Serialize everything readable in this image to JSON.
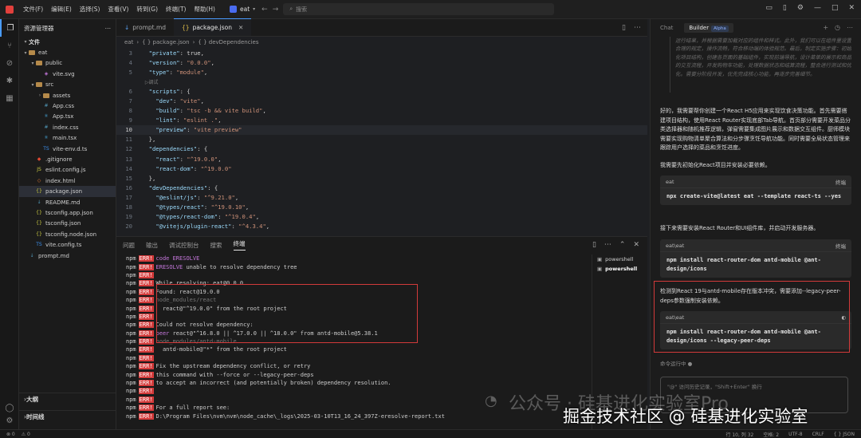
{
  "titlebar": {
    "menus": [
      "文件(F)",
      "编辑(E)",
      "选择(S)",
      "查看(V)",
      "转到(G)",
      "终端(T)",
      "帮助(H)"
    ],
    "project": "eat",
    "search_placeholder": "搜索"
  },
  "explorer": {
    "title": "资源管理器",
    "section": "文件",
    "items": [
      {
        "label": "eat",
        "depth": 0,
        "type": "folder",
        "open": true
      },
      {
        "label": "public",
        "depth": 1,
        "type": "folder",
        "open": true
      },
      {
        "label": "vite.svg",
        "depth": 2,
        "type": "svg"
      },
      {
        "label": "src",
        "depth": 1,
        "type": "folder",
        "open": true
      },
      {
        "label": "assets",
        "depth": 2,
        "type": "folder",
        "open": false
      },
      {
        "label": "App.css",
        "depth": 2,
        "type": "css"
      },
      {
        "label": "App.tsx",
        "depth": 2,
        "type": "tsx"
      },
      {
        "label": "index.css",
        "depth": 2,
        "type": "css"
      },
      {
        "label": "main.tsx",
        "depth": 2,
        "type": "tsx"
      },
      {
        "label": "vite-env.d.ts",
        "depth": 2,
        "type": "ts"
      },
      {
        "label": ".gitignore",
        "depth": 1,
        "type": "git"
      },
      {
        "label": "eslint.config.js",
        "depth": 1,
        "type": "js"
      },
      {
        "label": "index.html",
        "depth": 1,
        "type": "html"
      },
      {
        "label": "package.json",
        "depth": 1,
        "type": "json",
        "selected": true
      },
      {
        "label": "README.md",
        "depth": 1,
        "type": "md"
      },
      {
        "label": "tsconfig.app.json",
        "depth": 1,
        "type": "json"
      },
      {
        "label": "tsconfig.json",
        "depth": 1,
        "type": "json"
      },
      {
        "label": "tsconfig.node.json",
        "depth": 1,
        "type": "json"
      },
      {
        "label": "vite.config.ts",
        "depth": 1,
        "type": "ts"
      },
      {
        "label": "prompt.md",
        "depth": 0,
        "type": "md"
      }
    ],
    "outline": "大纲",
    "timeline": "时间线"
  },
  "editor": {
    "tabs": [
      {
        "label": "prompt.md",
        "active": false
      },
      {
        "label": "package.json",
        "active": true
      }
    ],
    "breadcrumb": [
      "eat",
      "{ } package.json",
      "{ } devDependencies"
    ],
    "current_line": 10,
    "lines": [
      {
        "n": 3,
        "code": "  \"private\": true,"
      },
      {
        "n": 4,
        "code": "  \"version\": \"0.0.0\","
      },
      {
        "n": 5,
        "code": "  \"type\": \"module\","
      },
      {
        "n": "",
        "code": "  ▷调试"
      },
      {
        "n": 6,
        "code": "  \"scripts\": {"
      },
      {
        "n": 7,
        "code": "    \"dev\": \"vite\","
      },
      {
        "n": 8,
        "code": "    \"build\": \"tsc -b && vite build\","
      },
      {
        "n": 9,
        "code": "    \"lint\": \"eslint .\","
      },
      {
        "n": 10,
        "code": "    \"preview\": \"vite preview\""
      },
      {
        "n": 11,
        "code": "  },"
      },
      {
        "n": 12,
        "code": "  \"dependencies\": {"
      },
      {
        "n": 13,
        "code": "    \"react\": \"^19.0.0\","
      },
      {
        "n": 14,
        "code": "    \"react-dom\": \"^19.0.0\""
      },
      {
        "n": 15,
        "code": "  },"
      },
      {
        "n": 16,
        "code": "  \"devDependencies\": {"
      },
      {
        "n": 17,
        "code": "    \"@eslint/js\": \"^9.21.0\","
      },
      {
        "n": 18,
        "code": "    \"@types/react\": \"^19.0.10\","
      },
      {
        "n": 19,
        "code": "    \"@types/react-dom\": \"^19.0.4\","
      },
      {
        "n": 20,
        "code": "    \"@vitejs/plugin-react\": \"^4.3.4\","
      }
    ]
  },
  "panel": {
    "tabs": [
      {
        "label": "问题",
        "active": false
      },
      {
        "label": "输出",
        "active": false
      },
      {
        "label": "调试控制台",
        "active": false
      },
      {
        "label": "搜索",
        "active": false
      },
      {
        "label": "终端",
        "active": true
      }
    ],
    "terminals": [
      {
        "label": "powershell",
        "active": false
      },
      {
        "label": "powershell",
        "active": true
      }
    ],
    "lines": [
      {
        "prefix": true,
        "text": "code ERESOLVE",
        "kind": "ecode"
      },
      {
        "prefix": true,
        "text": "ERESOLVE unable to resolve dependency tree",
        "kind": "ecode-lead"
      },
      {
        "prefix": true,
        "text": "",
        "kind": "plain"
      },
      {
        "prefix": true,
        "text": "While resolving: eat@0.0.0",
        "kind": "plain"
      },
      {
        "prefix": true,
        "text": "Found: react@19.0.0",
        "kind": "plain"
      },
      {
        "prefix": true,
        "text": "node_modules/react",
        "kind": "grey"
      },
      {
        "prefix": true,
        "text": "  react@\"^19.0.0\" from the root project",
        "kind": "plain"
      },
      {
        "prefix": true,
        "text": "",
        "kind": "plain"
      },
      {
        "prefix": true,
        "text": "Could not resolve dependency:",
        "kind": "plain"
      },
      {
        "prefix": true,
        "text": "peer react@\"^16.8.0 || ^17.0.0 || ^18.0.0\" from antd-mobile@5.38.1",
        "kind": "peer"
      },
      {
        "prefix": true,
        "text": "node_modules/antd-mobile",
        "kind": "grey"
      },
      {
        "prefix": true,
        "text": "  antd-mobile@\"*\" from the root project",
        "kind": "plain"
      },
      {
        "prefix": true,
        "text": "",
        "kind": "plain"
      },
      {
        "prefix": true,
        "text": "Fix the upstream dependency conflict, or retry",
        "kind": "plain"
      },
      {
        "prefix": true,
        "text": "this command with --force or --legacy-peer-deps",
        "kind": "plain"
      },
      {
        "prefix": true,
        "text": "to accept an incorrect (and potentially broken) dependency resolution.",
        "kind": "plain"
      },
      {
        "prefix": true,
        "text": "",
        "kind": "plain"
      },
      {
        "prefix": true,
        "text": "",
        "kind": "plain"
      },
      {
        "prefix": true,
        "text": "For a full report see:",
        "kind": "plain"
      },
      {
        "prefix": true,
        "text": "D:\\Program Files\\nvm\\nvm\\node_cache\\_logs\\2025-03-10T13_16_24_397Z-eresolve-report.txt",
        "kind": "plain"
      }
    ],
    "npm": "npm",
    "err": "ERR!"
  },
  "ai": {
    "tabs": [
      {
        "label": "Chat",
        "active": false
      },
      {
        "label": "Builder",
        "active": true
      }
    ],
    "alpha": "Alpha",
    "faded_text": "运行结果，并根据需要加载对应的组件和样式。此外，我们可以在组件里设置合理的规定，操作流畅，符合移动端的体验规范。最后，制定实施步骤：初始化项目结构，创建各页面的基础组件，实现前端导航，设计菜单的展示和商品的交互流程，开发购物车功能，处理数据状态和结算流程，整合进行测试和优化。需要分阶段开发，优先完成核心功能，再逐步完善细节。",
    "intro": "好的，我需要帮你创建一个React H5应用来实现饮食决策功能。首先需要搭建项目结构，使用React Router实现底部Tab导航。首页部分需要开发菜品分类选择器和随机推荐逻辑，弹窗需要集成图片展示和数据交互组件。厨师模块需要实现购物清单聚合算法和分步骤烹饪导航功能。同时需要全局状态管理来跟踪用户选择的菜品和烹饪进度。",
    "step1": "我需要先初始化React项目并安装必要依赖。",
    "cmd1_dir": "eat",
    "cmd1_action": "终端",
    "cmd1_text": "npx create-vite@latest eat --template react-ts --yes",
    "step2": "接下来需要安装React Router和UI组件库，并启动开发服务器。",
    "cmd2_dir": "eat\\eat",
    "cmd2_action": "终端",
    "cmd2_text": "npm install react-router-dom antd-mobile @ant-design/icons",
    "step3": "检测到React 19与antd-mobile存在版本冲突，需要添加--legacy-peer-deps参数强制安装依赖。",
    "cmd3_dir": "eat\\eat",
    "cmd3_text": "npm install react-router-dom antd-mobile @ant-design/icons --legacy-peer-deps",
    "running": "命令运行中 ●",
    "input_placeholder": "\"@\" 访问历史记录，\"Shift+Enter\" 换行"
  },
  "statusbar": {
    "items": [
      "行 10, 列 32",
      "空格: 2",
      "UTF-8",
      "CRLF",
      "{ } JSON"
    ]
  },
  "watermark": {
    "line1": "公众号 · 硅基进化实验室Pro",
    "line2": "掘金技术社区 @ 硅基进化实验室"
  }
}
